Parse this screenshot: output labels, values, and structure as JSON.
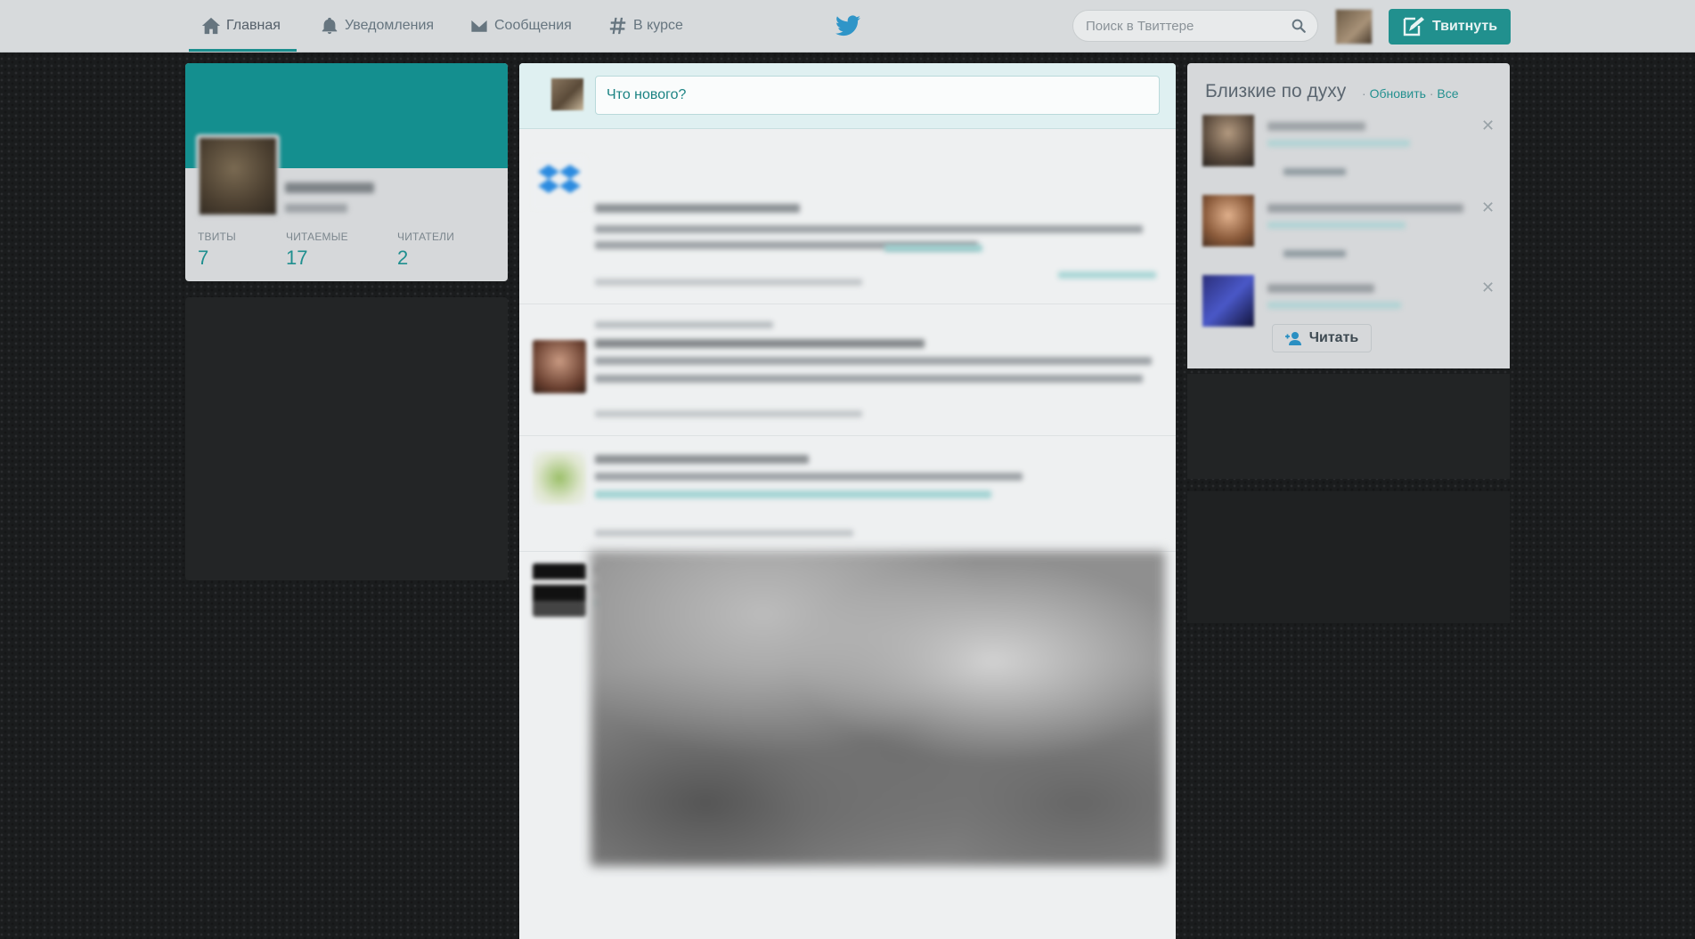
{
  "nav": {
    "home": "Главная",
    "notifications": "Уведомления",
    "messages": "Сообщения",
    "discover": "В курсе"
  },
  "search": {
    "placeholder": "Поиск в Твиттере"
  },
  "tweet_button": "Твитнуть",
  "profile": {
    "stats": [
      {
        "label": "ТВИТЫ",
        "value": "7"
      },
      {
        "label": "ЧИТАЕМЫЕ",
        "value": "17"
      },
      {
        "label": "ЧИТАТЕЛИ",
        "value": "2"
      }
    ]
  },
  "compose": {
    "placeholder": "Что нового?"
  },
  "who_to_follow": {
    "title": "Близкие по духу",
    "refresh": "Обновить",
    "all": "Все",
    "separator": "·",
    "follow_label": "Читать"
  },
  "colors": {
    "accent": "#1f8f8f",
    "topbar": "#d7dadc",
    "background": "#1a1c1d"
  },
  "icons": [
    "home-icon",
    "bell-icon",
    "envelope-icon",
    "hash-icon",
    "twitter-bird-icon",
    "search-icon",
    "compose-icon",
    "add-user-icon",
    "close-icon"
  ]
}
